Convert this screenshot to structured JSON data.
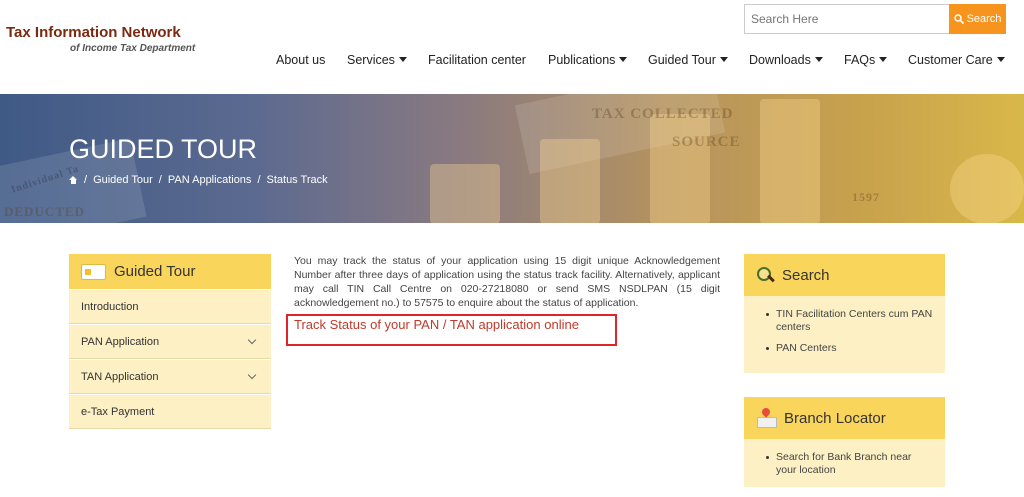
{
  "header": {
    "logo_title": "Tax Information Network",
    "logo_subtitle": "of Income Tax Department",
    "search_placeholder": "Search Here",
    "search_button": "Search"
  },
  "nav": {
    "items": [
      {
        "label": "About us",
        "dropdown": false
      },
      {
        "label": "Services",
        "dropdown": true
      },
      {
        "label": "Facilitation center",
        "dropdown": false
      },
      {
        "label": "Publications",
        "dropdown": true
      },
      {
        "label": "Guided Tour",
        "dropdown": true
      },
      {
        "label": "Downloads",
        "dropdown": true
      },
      {
        "label": "FAQs",
        "dropdown": true
      },
      {
        "label": "Customer Care",
        "dropdown": true
      }
    ]
  },
  "banner": {
    "title": "GUIDED TOUR",
    "breadcrumb": [
      "Guided Tour",
      "PAN Applications",
      "Status Track"
    ],
    "separator": "/",
    "stamp_1": "TAX COLLECTED",
    "stamp_2": "SOURCE",
    "stamp_3": "DEDUCTED",
    "stamp_4": "Individual Ta",
    "stamp_5": "1597"
  },
  "sidebar": {
    "heading": "Guided Tour",
    "items": [
      {
        "label": "Introduction",
        "expandable": false
      },
      {
        "label": "PAN Application",
        "expandable": true
      },
      {
        "label": "TAN Application",
        "expandable": true
      },
      {
        "label": "e-Tax Payment",
        "expandable": false
      }
    ]
  },
  "main": {
    "paragraph": "You may track the status of your application using 15 digit unique Acknowledgement Number after three days of application using the status track facility. Alternatively, applicant may call TIN Call Centre on 020-27218080 or send SMS NSDLPAN (15 digit acknowledgement no.) to 57575 to enquire about the status of application.",
    "track_link": "Track Status of your PAN / TAN application online"
  },
  "right": {
    "search": {
      "heading": "Search",
      "items": [
        "TIN Facilitation Centers cum PAN centers",
        "PAN Centers"
      ]
    },
    "branch": {
      "heading": "Branch Locator",
      "items": [
        "Search for Bank Branch near your location"
      ]
    }
  },
  "colors": {
    "accent": "#f7941d",
    "panel_header": "#fad55c",
    "panel_body": "#fdf0c4",
    "link": "#c0392b",
    "highlight": "#e0242c"
  }
}
